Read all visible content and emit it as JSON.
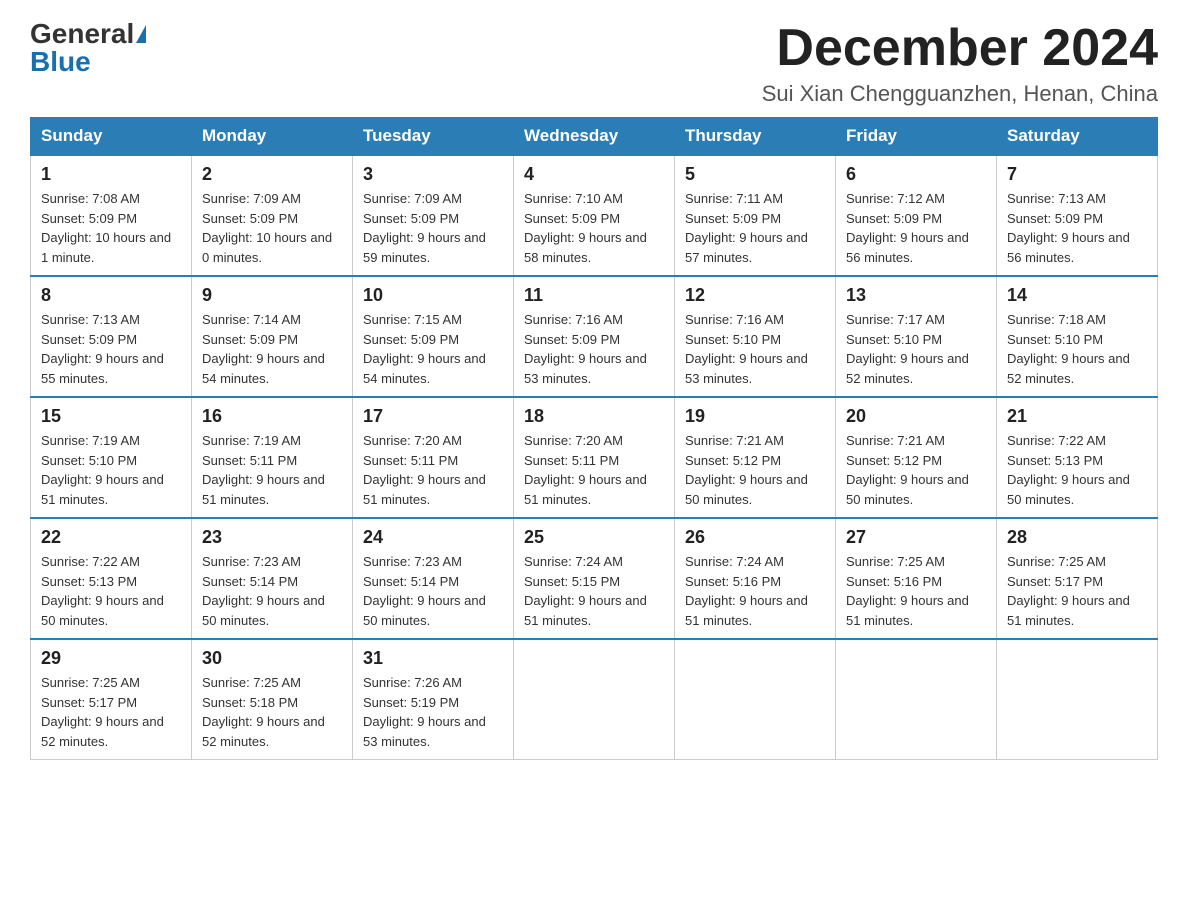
{
  "logo": {
    "general": "General",
    "blue": "Blue",
    "triangle": "▲"
  },
  "header": {
    "month_title": "December 2024",
    "subtitle": "Sui Xian Chengguanzhen, Henan, China"
  },
  "days_of_week": [
    "Sunday",
    "Monday",
    "Tuesday",
    "Wednesday",
    "Thursday",
    "Friday",
    "Saturday"
  ],
  "weeks": [
    [
      {
        "day": "1",
        "sunrise": "7:08 AM",
        "sunset": "5:09 PM",
        "daylight": "10 hours and 1 minute."
      },
      {
        "day": "2",
        "sunrise": "7:09 AM",
        "sunset": "5:09 PM",
        "daylight": "10 hours and 0 minutes."
      },
      {
        "day": "3",
        "sunrise": "7:09 AM",
        "sunset": "5:09 PM",
        "daylight": "9 hours and 59 minutes."
      },
      {
        "day": "4",
        "sunrise": "7:10 AM",
        "sunset": "5:09 PM",
        "daylight": "9 hours and 58 minutes."
      },
      {
        "day": "5",
        "sunrise": "7:11 AM",
        "sunset": "5:09 PM",
        "daylight": "9 hours and 57 minutes."
      },
      {
        "day": "6",
        "sunrise": "7:12 AM",
        "sunset": "5:09 PM",
        "daylight": "9 hours and 56 minutes."
      },
      {
        "day": "7",
        "sunrise": "7:13 AM",
        "sunset": "5:09 PM",
        "daylight": "9 hours and 56 minutes."
      }
    ],
    [
      {
        "day": "8",
        "sunrise": "7:13 AM",
        "sunset": "5:09 PM",
        "daylight": "9 hours and 55 minutes."
      },
      {
        "day": "9",
        "sunrise": "7:14 AM",
        "sunset": "5:09 PM",
        "daylight": "9 hours and 54 minutes."
      },
      {
        "day": "10",
        "sunrise": "7:15 AM",
        "sunset": "5:09 PM",
        "daylight": "9 hours and 54 minutes."
      },
      {
        "day": "11",
        "sunrise": "7:16 AM",
        "sunset": "5:09 PM",
        "daylight": "9 hours and 53 minutes."
      },
      {
        "day": "12",
        "sunrise": "7:16 AM",
        "sunset": "5:10 PM",
        "daylight": "9 hours and 53 minutes."
      },
      {
        "day": "13",
        "sunrise": "7:17 AM",
        "sunset": "5:10 PM",
        "daylight": "9 hours and 52 minutes."
      },
      {
        "day": "14",
        "sunrise": "7:18 AM",
        "sunset": "5:10 PM",
        "daylight": "9 hours and 52 minutes."
      }
    ],
    [
      {
        "day": "15",
        "sunrise": "7:19 AM",
        "sunset": "5:10 PM",
        "daylight": "9 hours and 51 minutes."
      },
      {
        "day": "16",
        "sunrise": "7:19 AM",
        "sunset": "5:11 PM",
        "daylight": "9 hours and 51 minutes."
      },
      {
        "day": "17",
        "sunrise": "7:20 AM",
        "sunset": "5:11 PM",
        "daylight": "9 hours and 51 minutes."
      },
      {
        "day": "18",
        "sunrise": "7:20 AM",
        "sunset": "5:11 PM",
        "daylight": "9 hours and 51 minutes."
      },
      {
        "day": "19",
        "sunrise": "7:21 AM",
        "sunset": "5:12 PM",
        "daylight": "9 hours and 50 minutes."
      },
      {
        "day": "20",
        "sunrise": "7:21 AM",
        "sunset": "5:12 PM",
        "daylight": "9 hours and 50 minutes."
      },
      {
        "day": "21",
        "sunrise": "7:22 AM",
        "sunset": "5:13 PM",
        "daylight": "9 hours and 50 minutes."
      }
    ],
    [
      {
        "day": "22",
        "sunrise": "7:22 AM",
        "sunset": "5:13 PM",
        "daylight": "9 hours and 50 minutes."
      },
      {
        "day": "23",
        "sunrise": "7:23 AM",
        "sunset": "5:14 PM",
        "daylight": "9 hours and 50 minutes."
      },
      {
        "day": "24",
        "sunrise": "7:23 AM",
        "sunset": "5:14 PM",
        "daylight": "9 hours and 50 minutes."
      },
      {
        "day": "25",
        "sunrise": "7:24 AM",
        "sunset": "5:15 PM",
        "daylight": "9 hours and 51 minutes."
      },
      {
        "day": "26",
        "sunrise": "7:24 AM",
        "sunset": "5:16 PM",
        "daylight": "9 hours and 51 minutes."
      },
      {
        "day": "27",
        "sunrise": "7:25 AM",
        "sunset": "5:16 PM",
        "daylight": "9 hours and 51 minutes."
      },
      {
        "day": "28",
        "sunrise": "7:25 AM",
        "sunset": "5:17 PM",
        "daylight": "9 hours and 51 minutes."
      }
    ],
    [
      {
        "day": "29",
        "sunrise": "7:25 AM",
        "sunset": "5:17 PM",
        "daylight": "9 hours and 52 minutes."
      },
      {
        "day": "30",
        "sunrise": "7:25 AM",
        "sunset": "5:18 PM",
        "daylight": "9 hours and 52 minutes."
      },
      {
        "day": "31",
        "sunrise": "7:26 AM",
        "sunset": "5:19 PM",
        "daylight": "9 hours and 53 minutes."
      },
      null,
      null,
      null,
      null
    ]
  ]
}
